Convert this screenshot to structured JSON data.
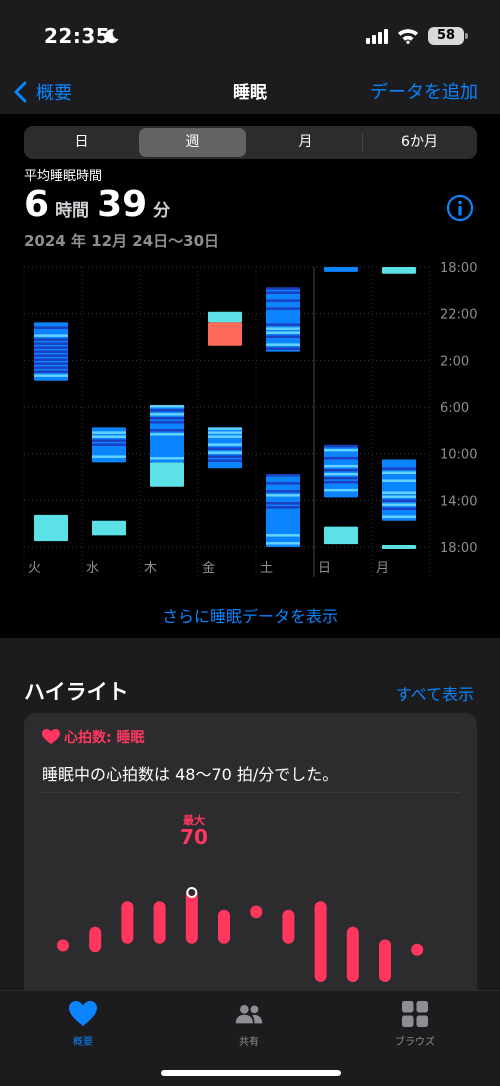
{
  "status": {
    "time": "22:35",
    "battery": "58"
  },
  "nav": {
    "back_label": "概要",
    "title": "睡眠",
    "add_label": "データを追加"
  },
  "segments": [
    "日",
    "週",
    "月",
    "6か月"
  ],
  "summary": {
    "label": "平均睡眠時間",
    "hours": "6",
    "hours_unit": "時間",
    "minutes": "39",
    "minutes_unit": "分",
    "date_range": "2024 年 12月 24日〜30日"
  },
  "chart_data": {
    "type": "bar",
    "days": [
      "火",
      "水",
      "木",
      "金",
      "土",
      "日",
      "月"
    ],
    "y_ticks": [
      "18:00",
      "22:00",
      "2:00",
      "6:00",
      "10:00",
      "14:00",
      "18:00"
    ],
    "ylim_hours_from_18": [
      0,
      24
    ],
    "in_bed_color": "#5ce1e6",
    "asleep_color": "#0a84ff",
    "awake_color": "#ff6b5b",
    "sessions": [
      {
        "day": "火",
        "kind": "asleep",
        "start": "22:45",
        "end": "03:45"
      },
      {
        "day": "火",
        "kind": "in_bed",
        "start": "15:15",
        "end": "17:30"
      },
      {
        "day": "水",
        "kind": "asleep",
        "start": "07:45",
        "end": "10:45"
      },
      {
        "day": "水",
        "kind": "in_bed",
        "start": "15:45",
        "end": "17:00"
      },
      {
        "day": "木",
        "kind": "asleep",
        "start": "05:50",
        "end": "10:45"
      },
      {
        "day": "木",
        "kind": "in_bed",
        "start": "10:45",
        "end": "12:50"
      },
      {
        "day": "金",
        "kind": "in_bed",
        "start": "21:50",
        "end": "22:45"
      },
      {
        "day": "金",
        "kind": "awake",
        "start": "22:45",
        "end": "00:45"
      },
      {
        "day": "金",
        "kind": "asleep",
        "start": "07:45",
        "end": "11:15"
      },
      {
        "day": "土",
        "kind": "asleep",
        "start": "19:45",
        "end": "01:15"
      },
      {
        "day": "土",
        "kind": "asleep",
        "start": "11:45",
        "end": "18:00"
      },
      {
        "day": "日",
        "kind": "asleep",
        "start": "18:00",
        "end": "18:25"
      },
      {
        "day": "日",
        "kind": "asleep",
        "start": "09:15",
        "end": "13:45"
      },
      {
        "day": "日",
        "kind": "in_bed",
        "start": "16:15",
        "end": "17:45"
      },
      {
        "day": "月",
        "kind": "in_bed",
        "start": "18:00",
        "end": "18:35"
      },
      {
        "day": "月",
        "kind": "asleep",
        "start": "10:30",
        "end": "15:45"
      },
      {
        "day": "月",
        "kind": "in_bed",
        "start": "17:50",
        "end": "18:00"
      }
    ]
  },
  "more_link": "さらに睡眠データを表示",
  "highlights": {
    "title": "ハイライト",
    "see_all": "すべて表示",
    "card": {
      "tag": "心拍数: 睡眠",
      "text": "睡眠中の心拍数は 48〜70 拍/分でした。",
      "max_label": "最大",
      "max_value": "70",
      "color": "#ff375f",
      "ranges": [
        {
          "low": 58,
          "high": 58
        },
        {
          "low": 55,
          "high": 61
        },
        {
          "low": 57,
          "high": 67
        },
        {
          "low": 57,
          "high": 67
        },
        {
          "low": 57,
          "high": 70
        },
        {
          "low": 57,
          "high": 65
        },
        {
          "low": 63,
          "high": 66
        },
        {
          "low": 57,
          "high": 65
        },
        {
          "low": 48,
          "high": 67
        },
        {
          "low": 48,
          "high": 61
        },
        {
          "low": 48,
          "high": 58
        },
        {
          "low": 56,
          "high": 57
        }
      ]
    }
  },
  "tabs": [
    {
      "label": "概要",
      "active": true
    },
    {
      "label": "共有",
      "active": false
    },
    {
      "label": "ブラウズ",
      "active": false
    }
  ]
}
